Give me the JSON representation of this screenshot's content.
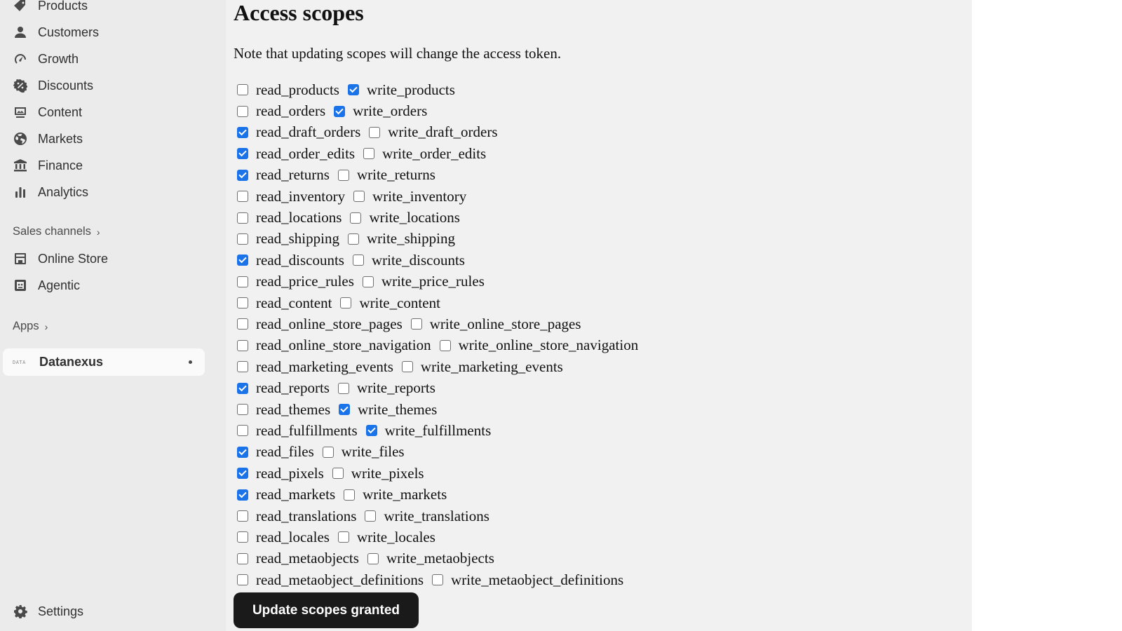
{
  "sidebar": {
    "items": [
      {
        "label": "Products",
        "icon": "tag-icon"
      },
      {
        "label": "Customers",
        "icon": "person-icon"
      },
      {
        "label": "Growth",
        "icon": "gauge-icon"
      },
      {
        "label": "Discounts",
        "icon": "discount-icon"
      },
      {
        "label": "Content",
        "icon": "content-icon"
      },
      {
        "label": "Markets",
        "icon": "globe-icon"
      },
      {
        "label": "Finance",
        "icon": "bank-icon"
      },
      {
        "label": "Analytics",
        "icon": "bar-chart-icon"
      }
    ],
    "sales_channels_label": "Sales channels",
    "channels": [
      {
        "label": "Online Store",
        "icon": "store-icon"
      },
      {
        "label": "Agentic",
        "icon": "agentic-icon"
      }
    ],
    "apps_label": "Apps",
    "active_app": {
      "label": "Datanexus",
      "logo_text": "DATA"
    },
    "settings_label": "Settings"
  },
  "main": {
    "title": "Access scopes",
    "note": "Note that updating scopes will change the access token.",
    "scopes": [
      {
        "read": "read_products",
        "read_checked": false,
        "write": "write_products",
        "write_checked": true
      },
      {
        "read": "read_orders",
        "read_checked": false,
        "write": "write_orders",
        "write_checked": true
      },
      {
        "read": "read_draft_orders",
        "read_checked": true,
        "write": "write_draft_orders",
        "write_checked": false
      },
      {
        "read": "read_order_edits",
        "read_checked": true,
        "write": "write_order_edits",
        "write_checked": false
      },
      {
        "read": "read_returns",
        "read_checked": true,
        "write": "write_returns",
        "write_checked": false
      },
      {
        "read": "read_inventory",
        "read_checked": false,
        "write": "write_inventory",
        "write_checked": false
      },
      {
        "read": "read_locations",
        "read_checked": false,
        "write": "write_locations",
        "write_checked": false
      },
      {
        "read": "read_shipping",
        "read_checked": false,
        "write": "write_shipping",
        "write_checked": false
      },
      {
        "read": "read_discounts",
        "read_checked": true,
        "write": "write_discounts",
        "write_checked": false
      },
      {
        "read": "read_price_rules",
        "read_checked": false,
        "write": "write_price_rules",
        "write_checked": false
      },
      {
        "read": "read_content",
        "read_checked": false,
        "write": "write_content",
        "write_checked": false
      },
      {
        "read": "read_online_store_pages",
        "read_checked": false,
        "write": "write_online_store_pages",
        "write_checked": false
      },
      {
        "read": "read_online_store_navigation",
        "read_checked": false,
        "write": "write_online_store_navigation",
        "write_checked": false
      },
      {
        "read": "read_marketing_events",
        "read_checked": false,
        "write": "write_marketing_events",
        "write_checked": false
      },
      {
        "read": "read_reports",
        "read_checked": true,
        "write": "write_reports",
        "write_checked": false
      },
      {
        "read": "read_themes",
        "read_checked": false,
        "write": "write_themes",
        "write_checked": true
      },
      {
        "read": "read_fulfillments",
        "read_checked": false,
        "write": "write_fulfillments",
        "write_checked": true
      },
      {
        "read": "read_files",
        "read_checked": true,
        "write": "write_files",
        "write_checked": false
      },
      {
        "read": "read_pixels",
        "read_checked": true,
        "write": "write_pixels",
        "write_checked": false
      },
      {
        "read": "read_markets",
        "read_checked": true,
        "write": "write_markets",
        "write_checked": false
      },
      {
        "read": "read_translations",
        "read_checked": false,
        "write": "write_translations",
        "write_checked": false
      },
      {
        "read": "read_locales",
        "read_checked": false,
        "write": "write_locales",
        "write_checked": false
      },
      {
        "read": "read_metaobjects",
        "read_checked": false,
        "write": "write_metaobjects",
        "write_checked": false
      },
      {
        "read": "read_metaobject_definitions",
        "read_checked": false,
        "write": "write_metaobject_definitions",
        "write_checked": false
      }
    ],
    "update_button_label": "Update scopes granted"
  },
  "colors": {
    "checkbox_checked": "#1a73e8",
    "button_bg": "#1a1a1a",
    "sidebar_bg": "#ebebeb",
    "main_bg": "#f1f1f1"
  }
}
